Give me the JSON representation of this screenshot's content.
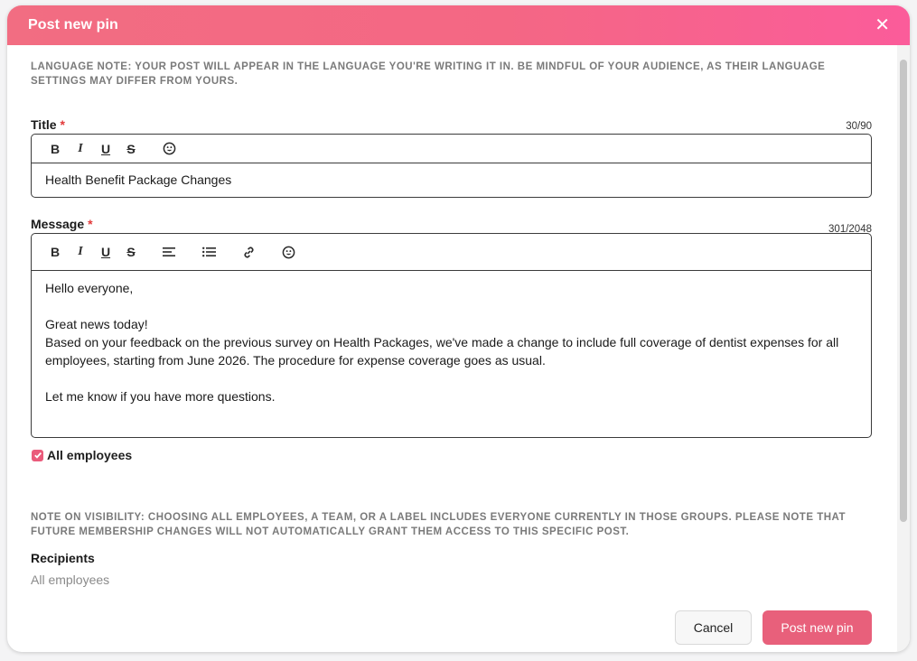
{
  "dialog": {
    "title": "Post new pin",
    "close_icon": "close-icon"
  },
  "language_note": "LANGUAGE NOTE: YOUR POST WILL APPEAR IN THE LANGUAGE YOU'RE WRITING IT IN. BE MINDFUL OF YOUR AUDIENCE, AS THEIR LANGUAGE SETTINGS MAY DIFFER FROM YOURS.",
  "title_field": {
    "label": "Title",
    "required_mark": "*",
    "counter": "30/90",
    "value": "Health Benefit Package Changes",
    "toolbar": [
      "bold-icon",
      "italic-icon",
      "underline-icon",
      "strikethrough-icon",
      "emoji-icon"
    ]
  },
  "message_field": {
    "label": "Message",
    "required_mark": "*",
    "counter": "301/2048",
    "toolbar": [
      "bold-icon",
      "italic-icon",
      "underline-icon",
      "strikethrough-icon",
      "align-left-icon",
      "bullet-list-icon",
      "link-icon",
      "emoji-icon"
    ],
    "lines": [
      "Hello everyone,",
      "",
      "Great news today!",
      "Based on your feedback on the previous survey on Health Packages, we've made a change to include full coverage of dentist expenses for all",
      "employees, starting from June 2026. The procedure for expense coverage goes as usual.",
      "",
      "Let me know if you have more questions."
    ]
  },
  "all_employees": {
    "label": "All employees",
    "checked": true
  },
  "visibility_note": "NOTE ON VISIBILITY: CHOOSING ALL EMPLOYEES, A TEAM, OR A LABEL INCLUDES EVERYONE CURRENTLY IN THOSE GROUPS. PLEASE NOTE THAT FUTURE MEMBERSHIP CHANGES WILL NOT AUTOMATICALLY GRANT THEM ACCESS TO THIS SPECIFIC POST.",
  "recipients": {
    "label": "Recipients",
    "value": "All employees"
  },
  "buttons": {
    "cancel": "Cancel",
    "post": "Post new pin"
  },
  "colors": {
    "header_gradient_start": "#f26d82",
    "header_gradient_end": "#fb5c9a",
    "accent": "#e8607b",
    "required": "#e23a3a"
  }
}
